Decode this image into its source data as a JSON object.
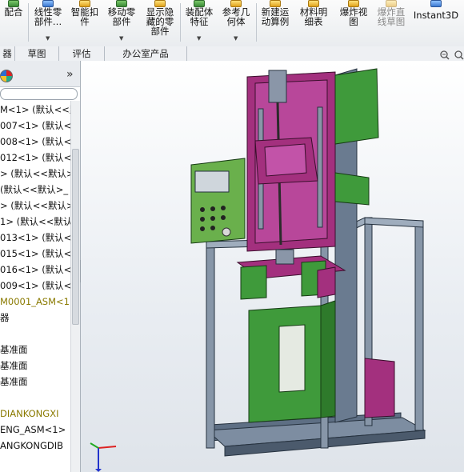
{
  "toolbar": {
    "buttons": [
      {
        "label": "配合",
        "icon": "mate-icon"
      },
      {
        "label": "线性零\n部件…",
        "icon": "linear-pattern-icon"
      },
      {
        "label": "智能扣\n件",
        "icon": "smart-fastener-icon"
      },
      {
        "label": "移动零\n部件",
        "icon": "move-component-icon"
      },
      {
        "label": "显示隐\n藏的零\n部件",
        "icon": "show-hidden-icon"
      },
      {
        "label": "装配体\n特征",
        "icon": "assembly-feature-icon"
      },
      {
        "label": "参考几\n何体",
        "icon": "reference-geometry-icon"
      },
      {
        "label": "新建运\n动算例",
        "icon": "motion-study-icon"
      },
      {
        "label": "材料明\n细表",
        "icon": "bom-icon"
      },
      {
        "label": "爆炸视\n图",
        "icon": "exploded-view-icon"
      },
      {
        "label": "爆炸直\n线草图",
        "icon": "explode-line-icon"
      },
      {
        "label": "Instant3D",
        "icon": "instant3d-icon"
      }
    ]
  },
  "tabs": [
    "器",
    "草图",
    "评估",
    "办公室产品"
  ],
  "panel": {
    "collapse_glyph": "»",
    "tree": [
      {
        "text": "M<1> (默认<<默"
      },
      {
        "text": "007<1> (默认<"
      },
      {
        "text": "008<1> (默认<"
      },
      {
        "text": "012<1> (默认<"
      },
      {
        "text": "> (默认<<默认>"
      },
      {
        "text": "(默认<<默认>_"
      },
      {
        "text": "> (默认<<默认>"
      },
      {
        "text": "1> (默认<<默认"
      },
      {
        "text": "013<1> (默认<"
      },
      {
        "text": "015<1> (默认<"
      },
      {
        "text": "016<1> (默认<"
      },
      {
        "text": "009<1> (默认<"
      },
      {
        "text": "M0001_ASM<1",
        "olive": true
      },
      {
        "text": "器"
      },
      {
        "text": ""
      },
      {
        "text": "基准面"
      },
      {
        "text": "基准面"
      },
      {
        "text": "基准面"
      },
      {
        "text": ""
      },
      {
        "text": "DIANKONGXI",
        "olive": true
      },
      {
        "text": "ENG_ASM<1>"
      },
      {
        "text": "ANGKONGDIB"
      }
    ]
  },
  "colors": {
    "magenta": "#a3307e",
    "green": "#3f9a3b",
    "frame": "#5e6f84",
    "panel_olive": "#8a7a00"
  }
}
